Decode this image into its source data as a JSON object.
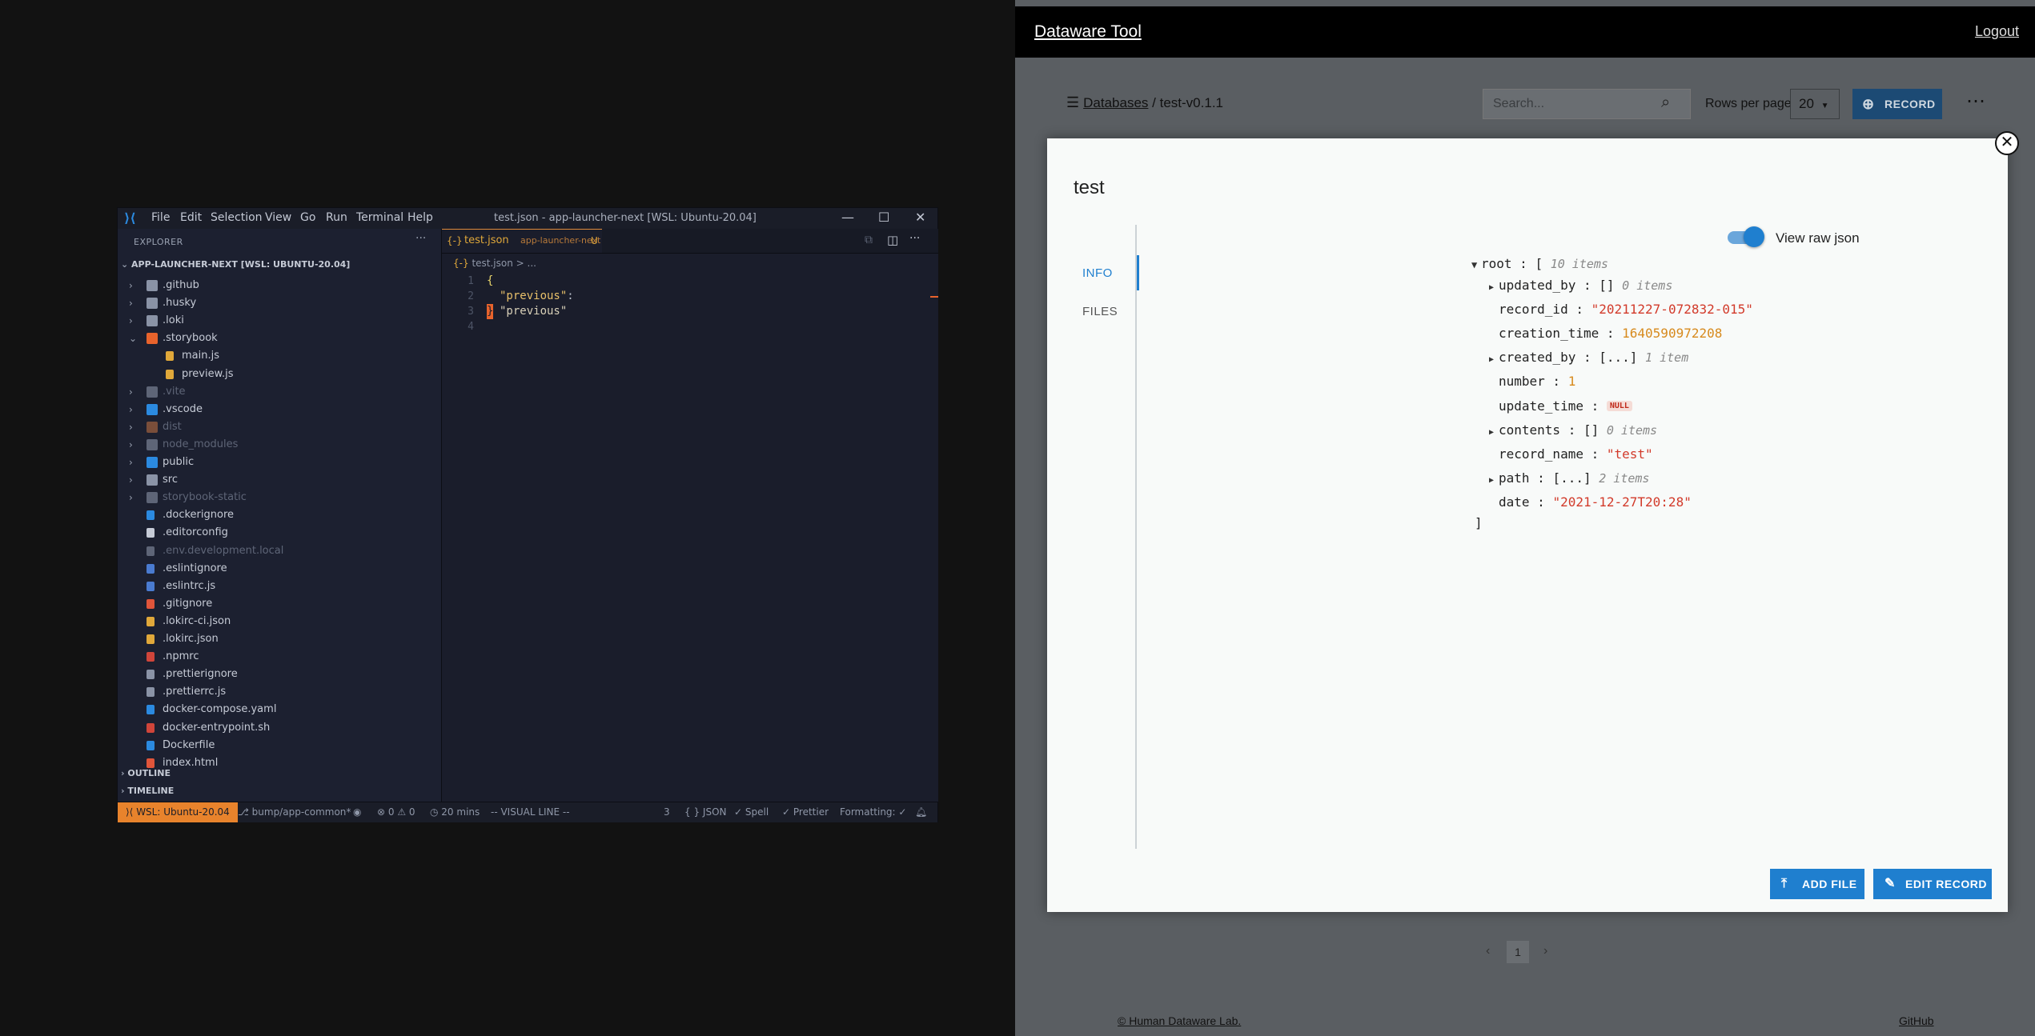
{
  "vscode": {
    "menu": [
      "File",
      "Edit",
      "Selection",
      "View",
      "Go",
      "Run",
      "Terminal",
      "Help"
    ],
    "window_title": "test.json - app-launcher-next [WSL: Ubuntu-20.04]",
    "explorer_label": "EXPLORER",
    "project_label": "APP-LAUNCHER-NEXT [WSL: UBUNTU-20.04]",
    "tree": [
      {
        "name": ".github",
        "type": "folder",
        "dim": false,
        "color": "#8a93a6"
      },
      {
        "name": ".husky",
        "type": "folder",
        "dim": false,
        "color": "#8a93a6"
      },
      {
        "name": ".loki",
        "type": "folder",
        "dim": false,
        "color": "#8a93a6"
      },
      {
        "name": ".storybook",
        "type": "folder-open",
        "dim": false,
        "color": "#e8632c"
      },
      {
        "name": "main.js",
        "type": "file",
        "dim": false,
        "color": "#e0a83a",
        "indent": true
      },
      {
        "name": "preview.js",
        "type": "file",
        "dim": false,
        "color": "#e0a83a",
        "indent": true
      },
      {
        "name": ".vite",
        "type": "folder",
        "dim": true,
        "color": "#5e6577"
      },
      {
        "name": ".vscode",
        "type": "folder",
        "dim": false,
        "color": "#2b8ae0"
      },
      {
        "name": "dist",
        "type": "folder",
        "dim": true,
        "color": "#7a4e3a"
      },
      {
        "name": "node_modules",
        "type": "folder",
        "dim": true,
        "color": "#5e6577"
      },
      {
        "name": "public",
        "type": "folder",
        "dim": false,
        "color": "#2b8ae0"
      },
      {
        "name": "src",
        "type": "folder",
        "dim": false,
        "color": "#8a93a6"
      },
      {
        "name": "storybook-static",
        "type": "folder",
        "dim": true,
        "color": "#5e6577"
      },
      {
        "name": ".dockerignore",
        "type": "file",
        "dim": false,
        "color": "#2b8ae0"
      },
      {
        "name": ".editorconfig",
        "type": "file",
        "dim": false,
        "color": "#c6cbd6"
      },
      {
        "name": ".env.development.local",
        "type": "file",
        "dim": true,
        "color": "#5e6577"
      },
      {
        "name": ".eslintignore",
        "type": "file",
        "dim": false,
        "color": "#4a7bd0"
      },
      {
        "name": ".eslintrc.js",
        "type": "file",
        "dim": false,
        "color": "#4a7bd0"
      },
      {
        "name": ".gitignore",
        "type": "file",
        "dim": false,
        "color": "#e0553a"
      },
      {
        "name": ".lokirc-ci.json",
        "type": "file",
        "dim": false,
        "color": "#e0a83a"
      },
      {
        "name": ".lokirc.json",
        "type": "file",
        "dim": false,
        "color": "#e0a83a"
      },
      {
        "name": ".npmrc",
        "type": "file",
        "dim": false,
        "color": "#d0453a"
      },
      {
        "name": ".prettierignore",
        "type": "file",
        "dim": false,
        "color": "#8a93a6"
      },
      {
        "name": ".prettierrc.js",
        "type": "file",
        "dim": false,
        "color": "#8a93a6"
      },
      {
        "name": "docker-compose.yaml",
        "type": "file",
        "dim": false,
        "color": "#2b8ae0"
      },
      {
        "name": "docker-entrypoint.sh",
        "type": "file",
        "dim": false,
        "color": "#d0453a"
      },
      {
        "name": "Dockerfile",
        "type": "file",
        "dim": false,
        "color": "#2b8ae0"
      },
      {
        "name": "index.html",
        "type": "file",
        "dim": false,
        "color": "#e0553a"
      }
    ],
    "outline_label": "OUTLINE",
    "timeline_label": "TIMELINE",
    "tab_icon": "{-}",
    "tab_file": "test.json",
    "tab_folder": "app-launcher-next",
    "tab_status": "U",
    "breadcrumb_icon": "{-}",
    "breadcrumb_file": "test.json",
    "breadcrumb_sep": "> ...",
    "code": [
      {
        "n": "1",
        "text": "{"
      },
      {
        "n": "2",
        "key": "\"previous\"",
        "sep": ": ",
        "val": "\"previous\""
      },
      {
        "n": "3",
        "text": "}"
      },
      {
        "n": "4",
        "text": ""
      }
    ],
    "status": {
      "wsl": "WSL: Ubuntu-20.04",
      "branch": "bump/app-common*",
      "errors": "⊗ 0 ⚠ 0",
      "time": "20 mins",
      "mode": "-- VISUAL LINE --",
      "sel": "3",
      "lang": "JSON",
      "spell": "Spell",
      "prettier": "Prettier",
      "formatting": "Formatting: ✓"
    }
  },
  "dataware": {
    "brand": "Dataware Tool",
    "logout": "Logout",
    "breadcrumb_root": "Databases",
    "breadcrumb_sep": "/",
    "breadcrumb_current": "test-v0.1.1",
    "search_placeholder": "Search...",
    "rows_label": "Rows per page",
    "rows_value": "20",
    "record_button": "RECORD",
    "modal": {
      "title": "test",
      "tab_info": "INFO",
      "tab_files": "FILES",
      "raw_json_label": "View raw json",
      "json": {
        "root_key": "root",
        "root_open": "[",
        "root_meta": "10 items",
        "root_close": "]",
        "rows": [
          {
            "key": "updated_by",
            "kind": "collapsed",
            "val": "[]",
            "meta": "0 items"
          },
          {
            "key": "record_id",
            "kind": "str",
            "val": "\"20211227-072832-015\""
          },
          {
            "key": "creation_time",
            "kind": "num",
            "val": "1640590972208"
          },
          {
            "key": "created_by",
            "kind": "collapsed",
            "val": "[...]",
            "meta": "1 item"
          },
          {
            "key": "number",
            "kind": "num",
            "val": "1"
          },
          {
            "key": "update_time",
            "kind": "null",
            "val": "NULL"
          },
          {
            "key": "contents",
            "kind": "collapsed",
            "val": "[]",
            "meta": "0 items"
          },
          {
            "key": "record_name",
            "kind": "str",
            "val": "\"test\""
          },
          {
            "key": "path",
            "kind": "collapsed",
            "val": "[...]",
            "meta": "2 items"
          },
          {
            "key": "date",
            "kind": "str",
            "val": "\"2021-12-27T20:28\""
          }
        ]
      },
      "add_file_button": "ADD FILE",
      "edit_record_button": "EDIT RECORD"
    },
    "pager": {
      "prev": "‹",
      "page": "1",
      "next": "›"
    },
    "footer_left": "© Human Dataware Lab.",
    "footer_right": "GitHub"
  }
}
